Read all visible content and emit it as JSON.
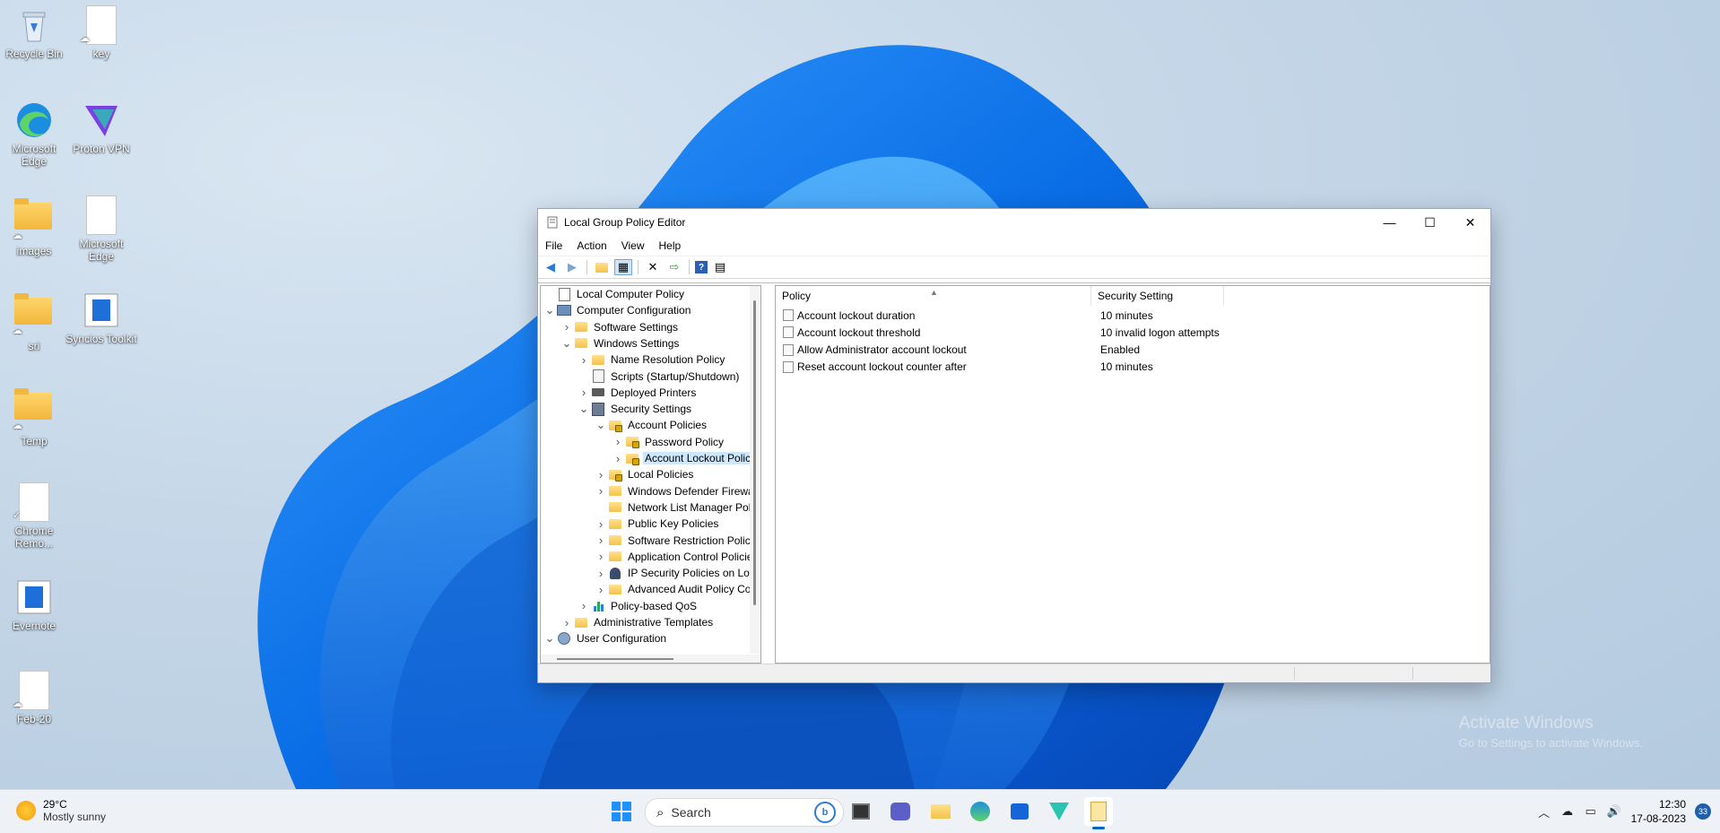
{
  "desktop": {
    "icons": [
      {
        "label": "Recycle Bin",
        "icon": "recycle-bin-icon"
      },
      {
        "label": "key",
        "icon": "document-icon"
      },
      {
        "label": "Microsoft Edge",
        "icon": "edge-icon"
      },
      {
        "label": "Proton VPN",
        "icon": "proton-vpn-icon"
      },
      {
        "label": "images",
        "icon": "folder-icon"
      },
      {
        "label": "Microsoft Edge",
        "icon": "document-icon"
      },
      {
        "label": "sri",
        "icon": "folder-icon"
      },
      {
        "label": "Syncios Toolkit",
        "icon": "syncios-icon"
      },
      {
        "label": "Temp",
        "icon": "folder-icon"
      },
      {
        "label": "Chrome Remo...",
        "icon": "document-icon"
      },
      {
        "label": "Evernote",
        "icon": "evernote-icon"
      },
      {
        "label": "Feb-20",
        "icon": "document-icon"
      }
    ],
    "watermark": {
      "line1": "Activate Windows",
      "line2": "Go to Settings to activate Windows."
    }
  },
  "window": {
    "title": "Local Group Policy Editor",
    "controls": {
      "minimize": "—",
      "maximize": "☐",
      "close": "✕"
    },
    "menu": [
      "File",
      "Action",
      "View",
      "Help"
    ],
    "tree": [
      {
        "label": "Local Computer Policy",
        "icon": "policy-icon",
        "arrow": ""
      },
      {
        "label": "Computer Configuration",
        "icon": "computer-icon",
        "arrow": "v"
      },
      {
        "label": "Software Settings",
        "icon": "folder-icon",
        "arrow": ">"
      },
      {
        "label": "Windows Settings",
        "icon": "folder-icon",
        "arrow": "v"
      },
      {
        "label": "Name Resolution Policy",
        "icon": "folder-icon",
        "arrow": ">"
      },
      {
        "label": "Scripts (Startup/Shutdown)",
        "icon": "script-icon",
        "arrow": ""
      },
      {
        "label": "Deployed Printers",
        "icon": "printer-icon",
        "arrow": ">"
      },
      {
        "label": "Security Settings",
        "icon": "security-icon",
        "arrow": "v"
      },
      {
        "label": "Account Policies",
        "icon": "folder-lock-icon",
        "arrow": "v"
      },
      {
        "label": "Password Policy",
        "icon": "folder-lock-icon",
        "arrow": ">"
      },
      {
        "label": "Account Lockout Polic",
        "icon": "folder-lock-icon",
        "arrow": ">"
      },
      {
        "label": "Local Policies",
        "icon": "folder-lock-icon",
        "arrow": ">"
      },
      {
        "label": "Windows Defender Firewal",
        "icon": "folder-icon",
        "arrow": ">"
      },
      {
        "label": "Network List Manager Poli",
        "icon": "folder-icon",
        "arrow": ""
      },
      {
        "label": "Public Key Policies",
        "icon": "folder-icon",
        "arrow": ">"
      },
      {
        "label": "Software Restriction Policie",
        "icon": "folder-icon",
        "arrow": ">"
      },
      {
        "label": "Application Control Policie",
        "icon": "folder-icon",
        "arrow": ">"
      },
      {
        "label": "IP Security Policies on Loca",
        "icon": "ipsec-icon",
        "arrow": ">"
      },
      {
        "label": "Advanced Audit Policy Cor",
        "icon": "folder-icon",
        "arrow": ">"
      },
      {
        "label": "Policy-based QoS",
        "icon": "chart-icon",
        "arrow": ">"
      },
      {
        "label": "Administrative Templates",
        "icon": "folder-icon",
        "arrow": ">"
      },
      {
        "label": "User Configuration",
        "icon": "user-icon",
        "arrow": "v"
      }
    ],
    "selected_tree_item": "Account Lockout Polic",
    "list": {
      "columns": [
        "Policy",
        "Security Setting"
      ],
      "rows": [
        {
          "policy": "Account lockout duration",
          "setting": "10 minutes"
        },
        {
          "policy": "Account lockout threshold",
          "setting": "10 invalid logon attempts"
        },
        {
          "policy": "Allow Administrator account lockout",
          "setting": "Enabled"
        },
        {
          "policy": "Reset account lockout counter after",
          "setting": "10 minutes"
        }
      ]
    }
  },
  "taskbar": {
    "weather": {
      "temp": "29°C",
      "condition": "Mostly sunny"
    },
    "search_placeholder": "Search",
    "clock": {
      "time": "12:30",
      "date": "17-08-2023"
    },
    "notification_count": "33"
  },
  "colors": {
    "accent": "#0067c0",
    "selection": "#cce8ff"
  }
}
